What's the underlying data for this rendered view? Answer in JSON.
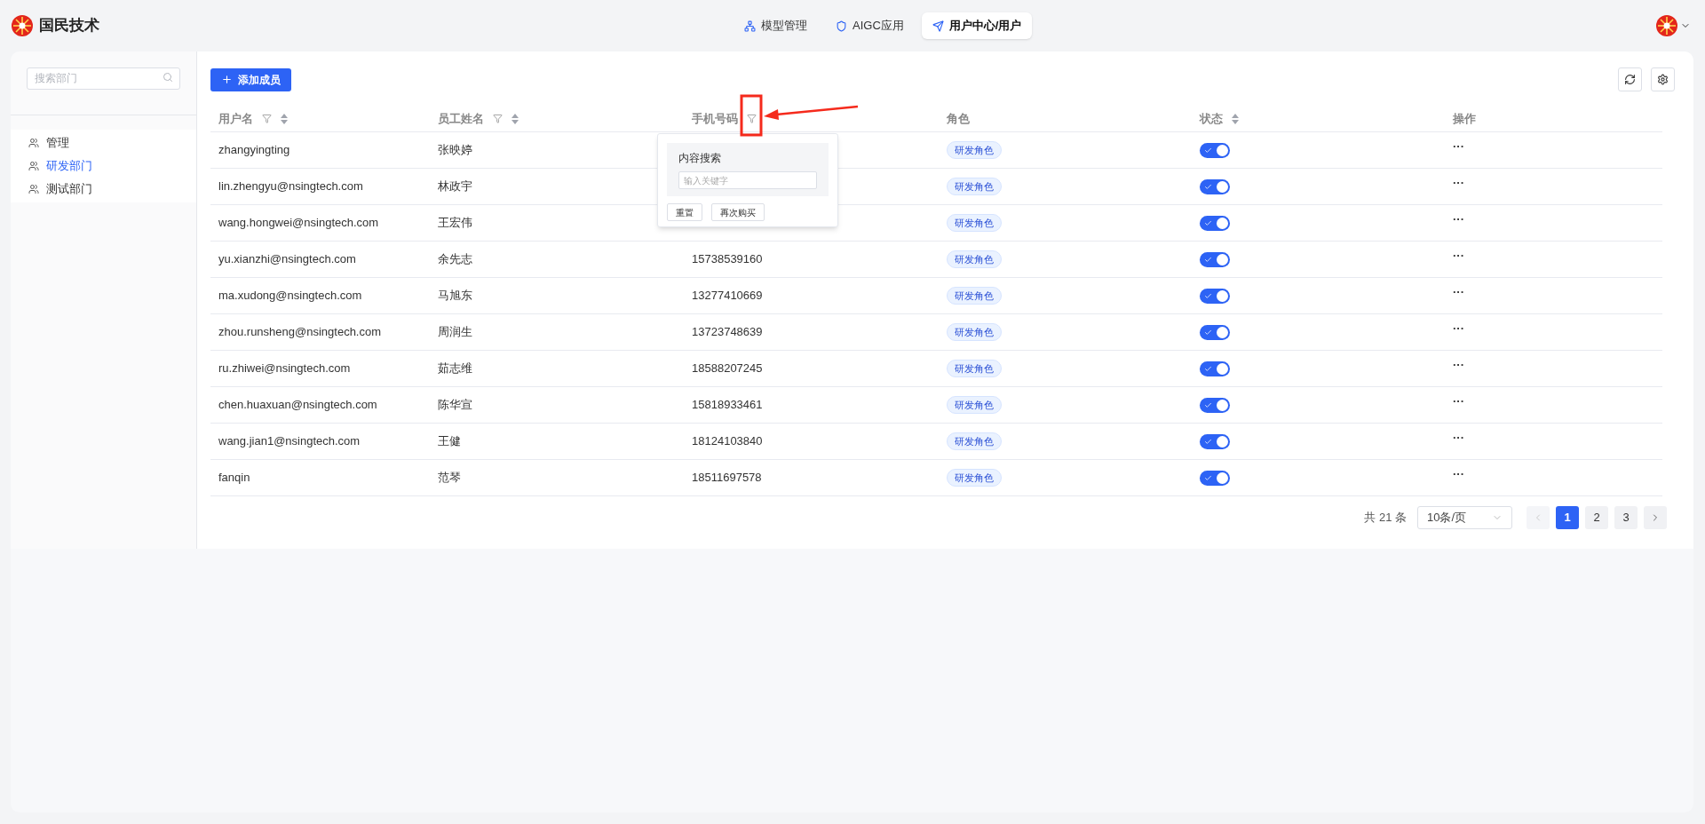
{
  "header": {
    "brand": "国民技术",
    "nav": [
      {
        "label": "模型管理",
        "selected": false,
        "kind": "models"
      },
      {
        "label": "AIGC应用",
        "selected": false,
        "kind": "apps"
      },
      {
        "label": "用户中心/用户",
        "selected": true,
        "kind": "users"
      }
    ]
  },
  "sidebar": {
    "search": {
      "placeholder": "搜索部门"
    },
    "departments": [
      {
        "label": "管理",
        "selected": false
      },
      {
        "label": "研发部门",
        "selected": true
      },
      {
        "label": "测试部门",
        "selected": false
      }
    ]
  },
  "toolbar": {
    "add_button": "添加成员"
  },
  "table": {
    "columns": [
      {
        "label": "用户名",
        "filter": true,
        "sort": true
      },
      {
        "label": "员工姓名",
        "filter": true,
        "sort": true
      },
      {
        "label": "手机号码",
        "filter": true,
        "sort": false
      },
      {
        "label": "角色",
        "filter": false,
        "sort": false
      },
      {
        "label": "状态",
        "filter": false,
        "sort": true
      },
      {
        "label": "操作",
        "filter": false,
        "sort": false
      }
    ],
    "rows": [
      {
        "username": "zhangyingting",
        "name": "张映婷",
        "role": "研发角色",
        "on": true,
        "action": "···"
      },
      {
        "username": "lin.zhengyu@nsingtech.com",
        "name": "林政宇",
        "role": "研发角色",
        "on": true,
        "action": "···"
      },
      {
        "username": "wang.hongwei@nsingtech.com",
        "name": "王宏伟",
        "role": "研发角色",
        "on": true,
        "action": "···"
      },
      {
        "username": "yu.xianzhi@nsingtech.com",
        "name": "余先志",
        "phone": "15738539160",
        "role": "研发角色",
        "on": true,
        "action": "···"
      },
      {
        "username": "ma.xudong@nsingtech.com",
        "name": "马旭东",
        "phone": "13277410669",
        "role": "研发角色",
        "on": true,
        "action": "···"
      },
      {
        "username": "zhou.runsheng@nsingtech.com",
        "name": "周润生",
        "phone": "13723748639",
        "role": "研发角色",
        "on": true,
        "action": "···"
      },
      {
        "username": "ru.zhiwei@nsingtech.com",
        "name": "茹志维",
        "phone": "18588207245",
        "role": "研发角色",
        "on": true,
        "action": "···"
      },
      {
        "username": "chen.huaxuan@nsingtech.com",
        "name": "陈华宣",
        "phone": "15818933461",
        "role": "研发角色",
        "on": true,
        "action": "···"
      },
      {
        "username": "wang.jian1@nsingtech.com",
        "name": "王健",
        "phone": "18124103840",
        "role": "研发角色",
        "on": true,
        "action": "···"
      },
      {
        "username": "fanqin",
        "name": "范琴",
        "phone": "18511697578",
        "role": "研发角色",
        "on": true,
        "action": "···"
      }
    ]
  },
  "filter_popover": {
    "title": "内容搜索",
    "placeholder": "输入关键字",
    "buttons": [
      "重置",
      "再次购买"
    ]
  },
  "pagination": {
    "total": "共 21 条",
    "page_size": "10条/页",
    "prev_disabled": true,
    "pages": [
      {
        "label": "1",
        "selected": true
      },
      {
        "label": "2",
        "selected": false
      },
      {
        "label": "3",
        "selected": false
      }
    ]
  }
}
